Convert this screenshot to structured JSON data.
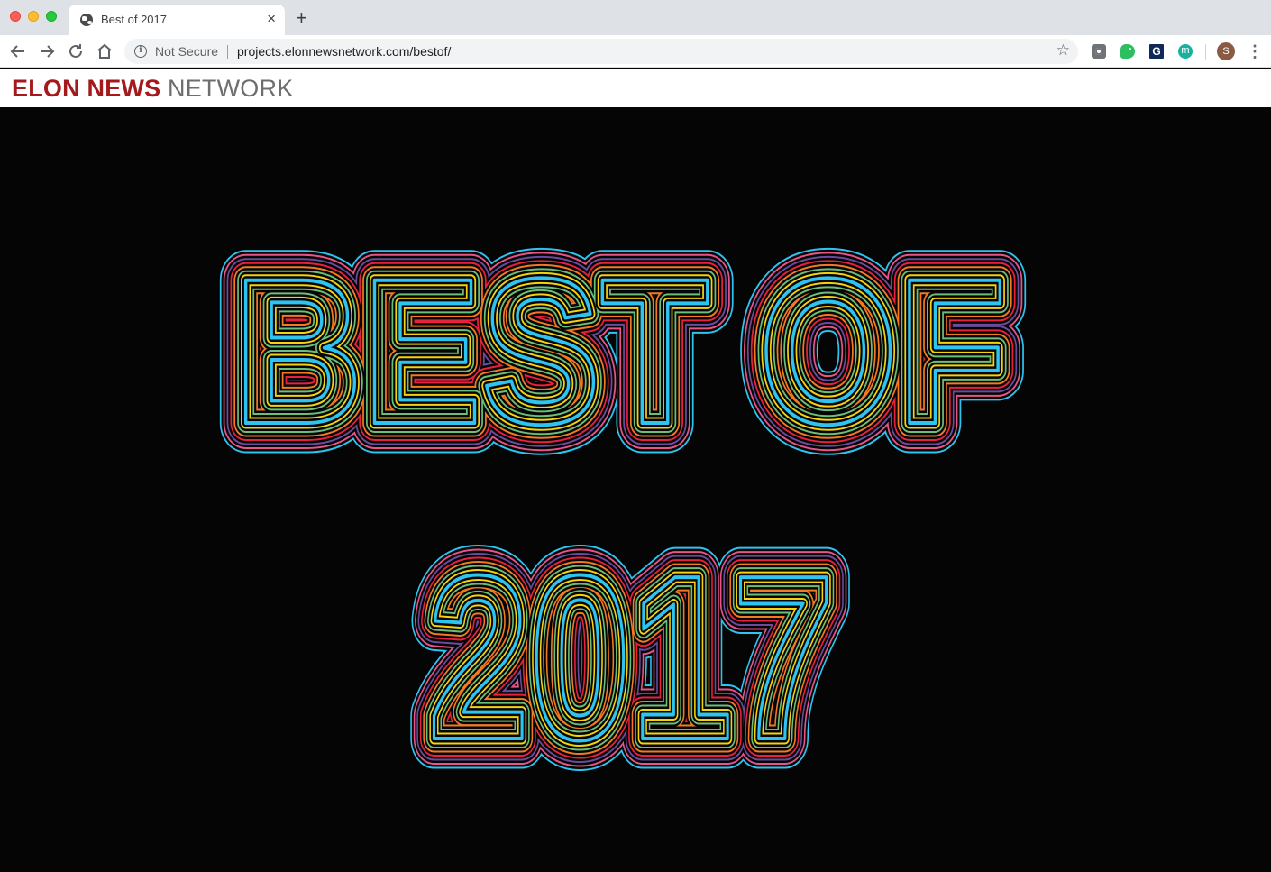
{
  "browser": {
    "tab_title": "Best of 2017",
    "tab_close": "×",
    "new_tab": "+",
    "security_label": "Not Secure",
    "url": "projects.elonnewsnetwork.com/bestof/",
    "avatar_initial": "S",
    "extension_g": "G",
    "extension_m": "m"
  },
  "site": {
    "logo_part1": "ELON NEWS",
    "logo_part2": " NETWORK"
  },
  "hero": {
    "line1": "BEST OF",
    "line2": "2017",
    "outline_colors": [
      "#2ec4f1",
      "#f5d10f",
      "#6bbf7a",
      "#f47a22",
      "#e8213f",
      "#6a4c9c",
      "#e7548a",
      "#2ec4f1"
    ]
  }
}
